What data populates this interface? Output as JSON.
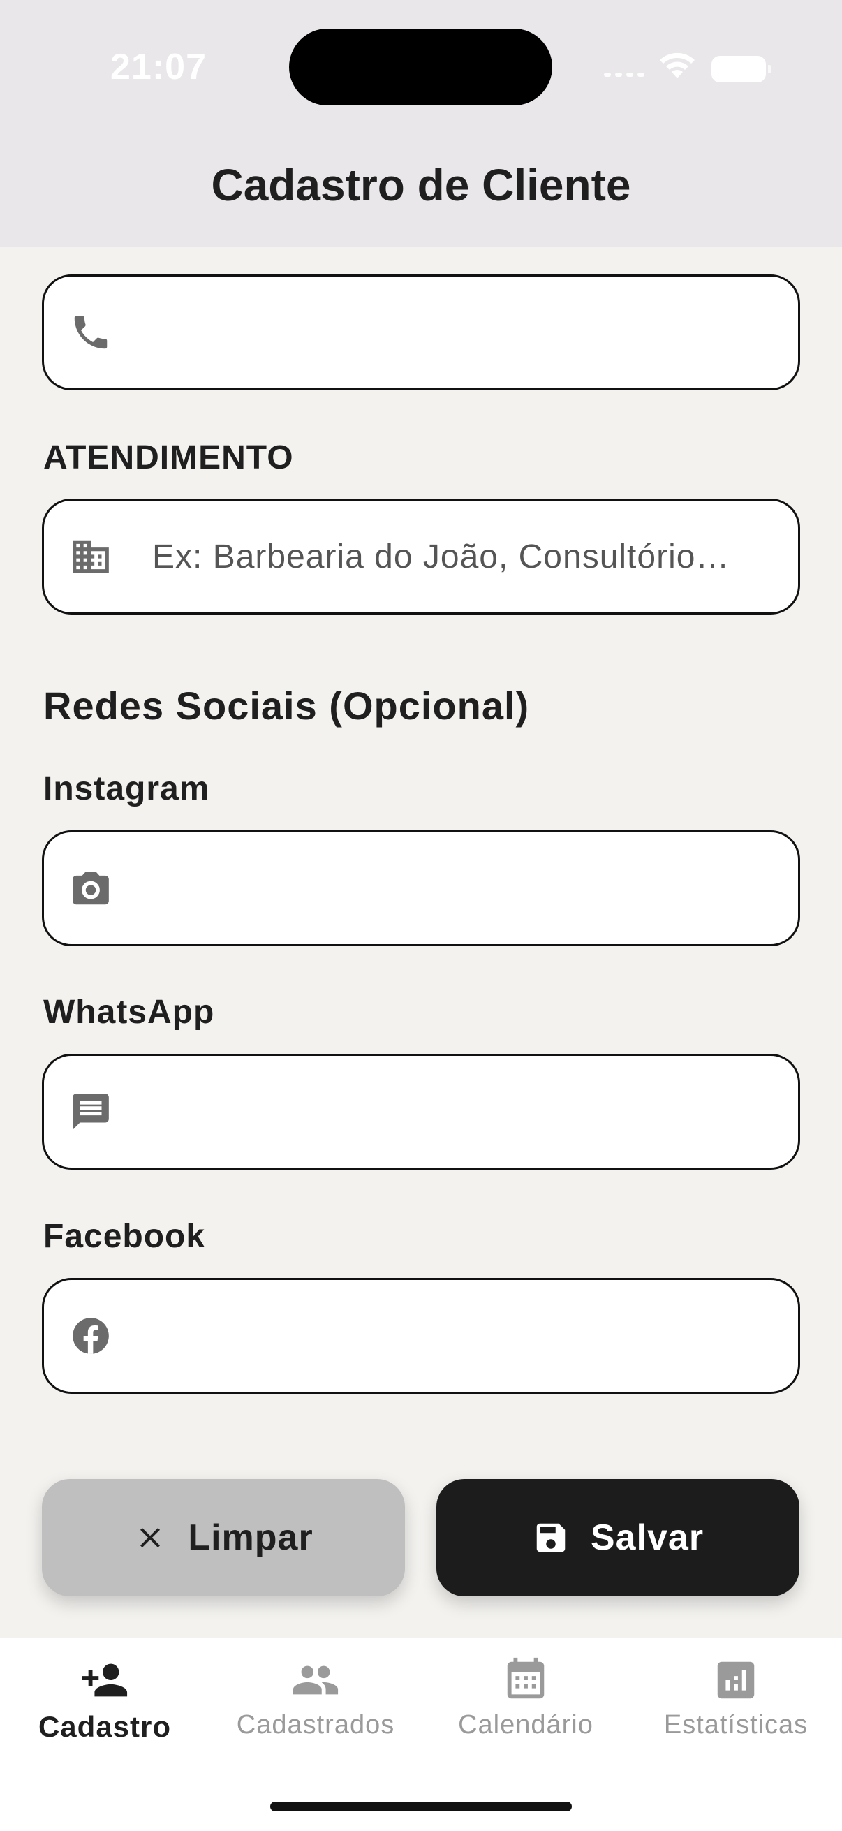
{
  "status_bar": {
    "time": "21:07"
  },
  "header": {
    "title": "Cadastro de Cliente"
  },
  "fields": {
    "phone": {
      "value": "",
      "placeholder": "",
      "icon": "phone-icon"
    },
    "atendimento": {
      "label": "ATENDIMENTO",
      "value": "",
      "placeholder": "Ex: Barbearia do João, Consultório…",
      "icon": "business-icon"
    }
  },
  "social": {
    "title": "Redes Sociais (Opcional)",
    "instagram": {
      "label": "Instagram",
      "value": "",
      "icon": "camera-icon"
    },
    "whatsapp": {
      "label": "WhatsApp",
      "value": "",
      "icon": "message-icon"
    },
    "facebook": {
      "label": "Facebook",
      "value": "",
      "icon": "facebook-icon"
    }
  },
  "actions": {
    "clear_label": "Limpar",
    "save_label": "Salvar"
  },
  "nav": {
    "items": [
      {
        "label": "Cadastro",
        "icon": "person-add-icon",
        "active": true
      },
      {
        "label": "Cadastrados",
        "icon": "people-icon",
        "active": false
      },
      {
        "label": "Calendário",
        "icon": "calendar-icon",
        "active": false
      },
      {
        "label": "Estatísticas",
        "icon": "chart-icon",
        "active": false
      }
    ]
  },
  "colors": {
    "background": "#f3f2ef",
    "header": "#e9e7e9",
    "primary": "#1c1c1c",
    "secondary_button": "#bfbfbf",
    "icon": "#6b6b6b"
  }
}
